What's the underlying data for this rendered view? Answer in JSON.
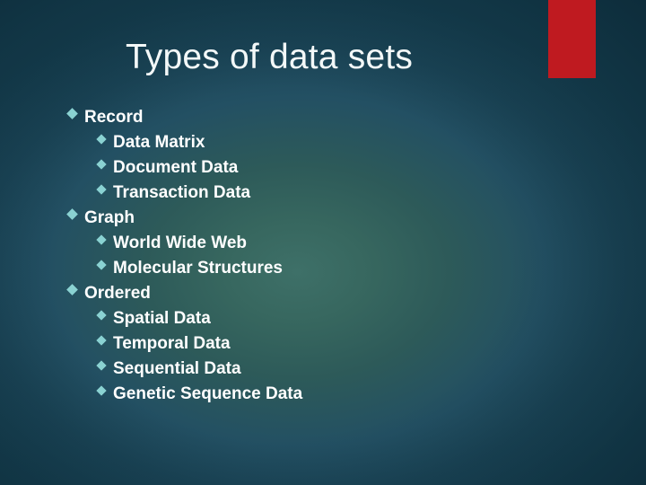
{
  "slide": {
    "title": "Types of data sets",
    "accent_color": "#bf1a20",
    "bullet_color": "#8ad2d2",
    "text_color": "#ffffff",
    "background_colors": [
      "#3e7068",
      "#235063",
      "#163f50"
    ],
    "bullet_icon": "diamond-bullet-icon",
    "outline": [
      {
        "level": 1,
        "label": "Record",
        "children": [
          {
            "level": 2,
            "label": "Data Matrix"
          },
          {
            "level": 2,
            "label": "Document Data"
          },
          {
            "level": 2,
            "label": "Transaction Data"
          }
        ]
      },
      {
        "level": 1,
        "label": "Graph",
        "children": [
          {
            "level": 2,
            "label": "World Wide Web"
          },
          {
            "level": 2,
            "label": "Molecular Structures"
          }
        ]
      },
      {
        "level": 1,
        "label": "Ordered",
        "children": [
          {
            "level": 2,
            "label": "Spatial Data"
          },
          {
            "level": 2,
            "label": "Temporal Data"
          },
          {
            "level": 2,
            "label": "Sequential Data"
          },
          {
            "level": 2,
            "label": "Genetic Sequence Data"
          }
        ]
      }
    ]
  }
}
